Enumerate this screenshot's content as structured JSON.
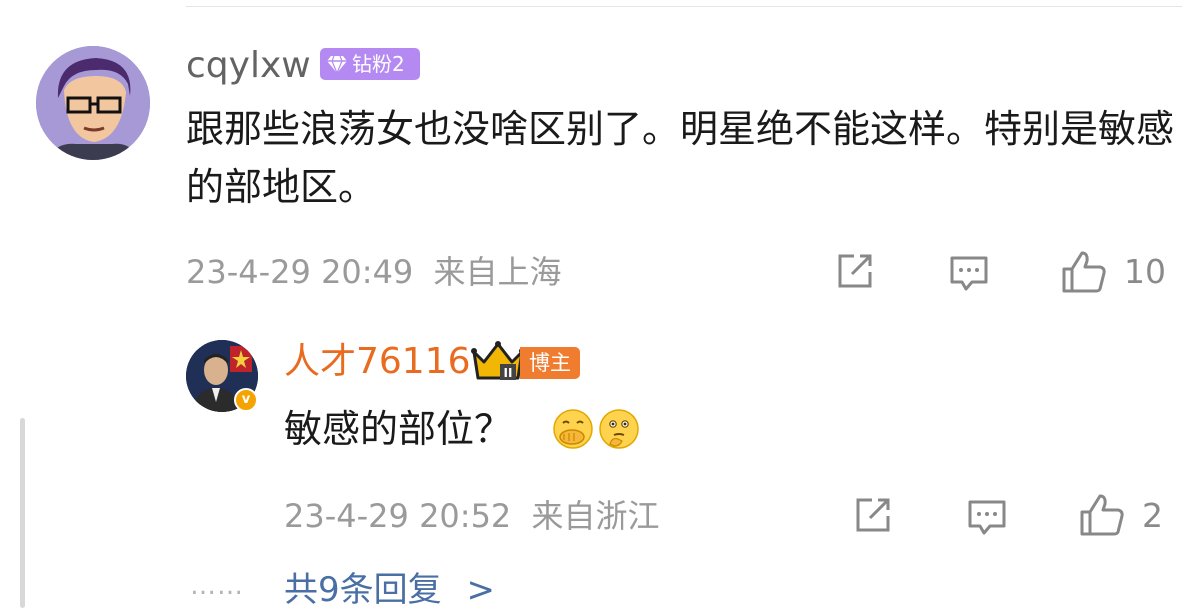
{
  "comment": {
    "username": "cqylxw",
    "badge_label": "钻粉2",
    "text": "跟那些浪荡女也没啥区别了。明星绝不能这样。特别是敏感的部地区。",
    "timestamp": "23-4-29 20:49",
    "location": "来自上海",
    "like_count": "10"
  },
  "reply": {
    "username": "人才76116",
    "verified_mark": "v",
    "badge_level": "II",
    "badge_label": "博主",
    "text": "敏感的部位？",
    "emojis": [
      "covering-mouth-emoji",
      "thinking-emoji"
    ],
    "timestamp": "23-4-29 20:52",
    "location": "来自浙江",
    "like_count": "2"
  },
  "more_replies": {
    "dots": "……",
    "label": "共9条回复",
    "chevron": ">"
  },
  "colors": {
    "username_primary": "#636363",
    "username_blogger": "#e86b1f",
    "badge_diamond": "#b48af2",
    "badge_blogger": "#f07c30",
    "meta_text": "#9a9a9a",
    "link": "#4a6fa5"
  }
}
